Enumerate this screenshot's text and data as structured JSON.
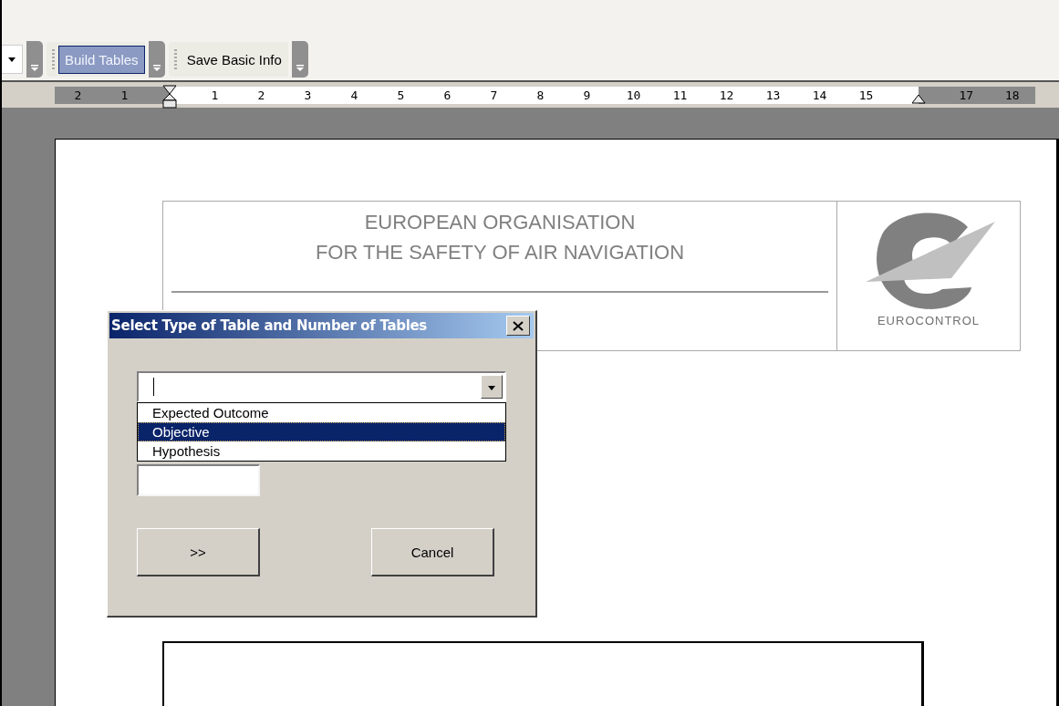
{
  "toolbar": {
    "items": [
      {
        "kind": "dropdown-stub"
      },
      {
        "kind": "button",
        "label": "Build Tables",
        "selected": true
      },
      {
        "kind": "button",
        "label": "Save Basic Info",
        "selected": false
      }
    ]
  },
  "ruler": {
    "left_margin_labels": [
      "2",
      "1"
    ],
    "body_labels": [
      "1",
      "2",
      "3",
      "4",
      "5",
      "6",
      "7",
      "8",
      "9",
      "10",
      "11",
      "12",
      "13",
      "14",
      "15"
    ],
    "right_margin_labels": [
      "17",
      "18"
    ]
  },
  "document": {
    "header": {
      "title_lines": [
        "EUROPEAN ORGANISATION",
        "FOR THE SAFETY OF AIR NAVIGATION"
      ],
      "logo_text": "EUROCONTROL"
    }
  },
  "dialog": {
    "title": "Select Type of Table and Number of Tables",
    "combo": {
      "options": [
        {
          "label": "Expected Outcome",
          "selected": false
        },
        {
          "label": "Objective",
          "selected": true
        },
        {
          "label": "Hypothesis",
          "selected": false
        }
      ]
    },
    "buttons": [
      {
        "label": ">>"
      },
      {
        "label": "Cancel"
      }
    ]
  }
}
